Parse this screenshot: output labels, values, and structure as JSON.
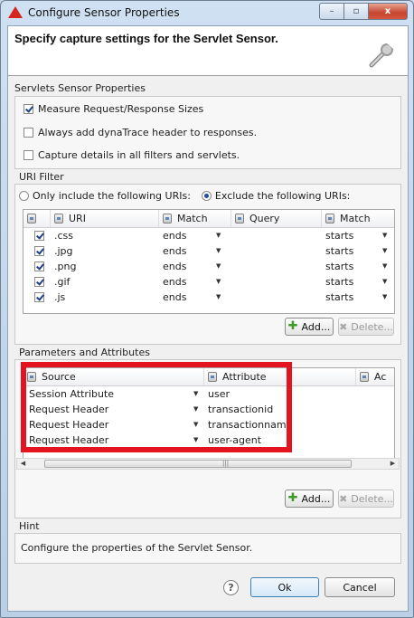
{
  "window": {
    "title": "Configure Sensor Properties",
    "controls": {
      "minimize": "–",
      "maximize": "▫",
      "close": "x"
    }
  },
  "header": {
    "title": "Specify capture settings for the Servlet Sensor."
  },
  "servlets_group": {
    "title": "Servlets Sensor Properties",
    "options": [
      {
        "label": "Measure Request/Response Sizes",
        "checked": true
      },
      {
        "label": "Always add dynaTrace header to responses.",
        "checked": false
      },
      {
        "label": "Capture details in all filters and servlets.",
        "checked": false
      }
    ]
  },
  "uri_filter": {
    "title": "URI Filter",
    "radio_include": "Only include the following URIs:",
    "radio_exclude": "Exclude the following URIs:",
    "selected": "exclude",
    "columns": [
      "URI",
      "Match",
      "Query",
      "Match"
    ],
    "rows": [
      {
        "checked": true,
        "uri": ".css",
        "match": "ends",
        "query": "",
        "query_match": "starts"
      },
      {
        "checked": true,
        "uri": ".jpg",
        "match": "ends",
        "query": "",
        "query_match": "starts"
      },
      {
        "checked": true,
        "uri": ".png",
        "match": "ends",
        "query": "",
        "query_match": "starts"
      },
      {
        "checked": true,
        "uri": ".gif",
        "match": "ends",
        "query": "",
        "query_match": "starts"
      },
      {
        "checked": true,
        "uri": ".js",
        "match": "ends",
        "query": "",
        "query_match": "starts"
      }
    ],
    "add_label": "Add...",
    "delete_label": "Delete..."
  },
  "params": {
    "title": "Parameters and Attributes",
    "columns": [
      "Source",
      "Attribute",
      "Ac"
    ],
    "rows": [
      {
        "source": "Session Attribute",
        "attribute": "user"
      },
      {
        "source": "Request Header",
        "attribute": "transactionid"
      },
      {
        "source": "Request Header",
        "attribute": "transactionname"
      },
      {
        "source": "Request Header",
        "attribute": "user-agent"
      }
    ],
    "add_label": "Add...",
    "delete_label": "Delete..."
  },
  "hint": {
    "title": "Hint",
    "text": "Configure the properties of the Servlet Sensor."
  },
  "footer": {
    "help": "?",
    "ok_label": "Ok",
    "cancel_label": "Cancel"
  },
  "colors": {
    "highlight": "#e3141f",
    "window_frame": "#b9cfe6"
  }
}
